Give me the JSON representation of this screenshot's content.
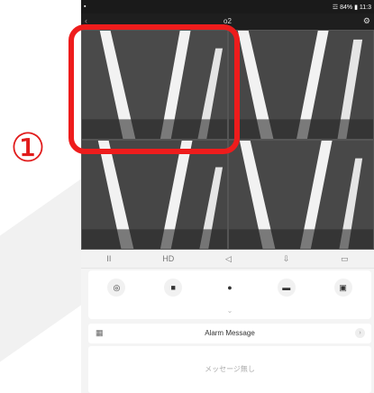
{
  "annotation": {
    "number": "①"
  },
  "status_bar": {
    "battery_time": "☲ 84% ▮ 11:3"
  },
  "header": {
    "title": "o2"
  },
  "control_bar": [
    {
      "icon": "pause-icon",
      "glyph": "II"
    },
    {
      "icon": "hd-icon",
      "glyph": "HD"
    },
    {
      "icon": "speaker-icon",
      "glyph": "◁"
    },
    {
      "icon": "save-icon",
      "glyph": "⇩"
    },
    {
      "icon": "multiscreen-icon",
      "glyph": "▭"
    }
  ],
  "actions": [
    {
      "icon": "ptz-icon",
      "glyph": "◎"
    },
    {
      "icon": "snapshot-icon",
      "glyph": "■"
    },
    {
      "icon": "microphone-icon",
      "glyph": "●"
    },
    {
      "icon": "record-icon",
      "glyph": "▬"
    },
    {
      "icon": "preset-icon",
      "glyph": "▣"
    }
  ],
  "alarm": {
    "label": "Alarm Message"
  },
  "messages": {
    "empty_text": "メッセージ無し"
  }
}
